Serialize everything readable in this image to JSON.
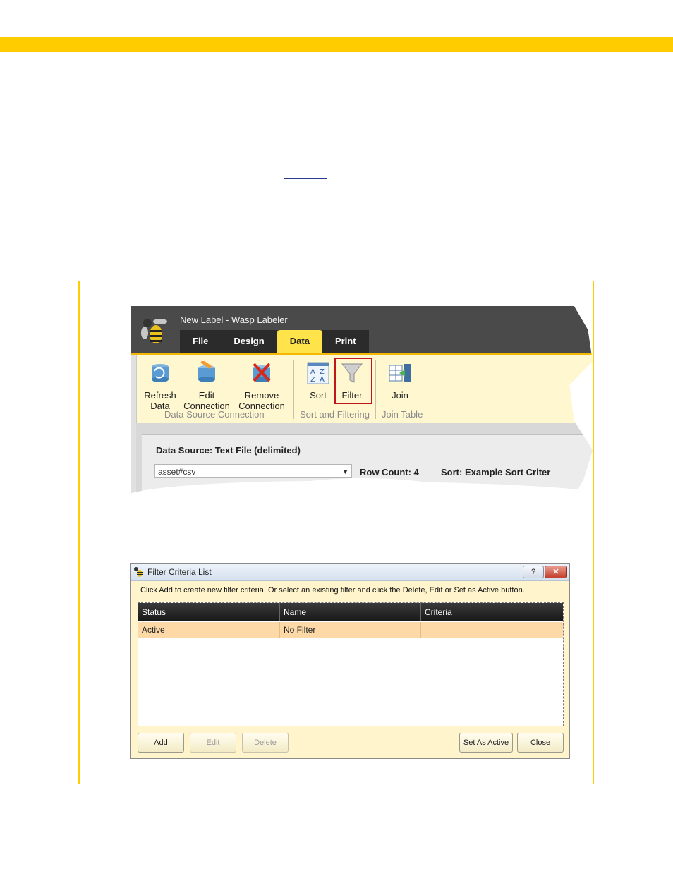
{
  "app": {
    "title": "New Label - Wasp Labeler",
    "tabs": [
      "File",
      "Design",
      "Data",
      "Print"
    ],
    "active_tab": "Data",
    "ribbon": {
      "refresh": "Refresh\nData",
      "edit": "Edit\nConnection",
      "remove": "Remove\nConnection",
      "group_ds": "Data Source Connection",
      "sort": "Sort",
      "filter": "Filter",
      "group_sf": "Sort and Filtering",
      "join": "Join",
      "group_join": "Join Table"
    },
    "data_source_label": "Data Source: Text File (delimited)",
    "data_source_value": "asset#csv",
    "row_count": "Row Count: 4",
    "sort_label": "Sort:  Example Sort Criter"
  },
  "dialog": {
    "title": "Filter Criteria List",
    "help": "?",
    "close_glyph": "✕",
    "instructions": "Click Add to create new filter criteria. Or select an existing filter and click the Delete, Edit or Set as Active button.",
    "columns": [
      "Status",
      "Name",
      "Criteria"
    ],
    "rows": [
      {
        "status": "Active",
        "name": "No Filter",
        "criteria": ""
      }
    ],
    "buttons": {
      "add": "Add",
      "edit": "Edit",
      "delete": "Delete",
      "set_active": "Set As Active",
      "close": "Close"
    }
  },
  "colors": {
    "accent": "#FFCC00",
    "ribbon": "#FFF7D0",
    "highlight": "#c0151a"
  }
}
